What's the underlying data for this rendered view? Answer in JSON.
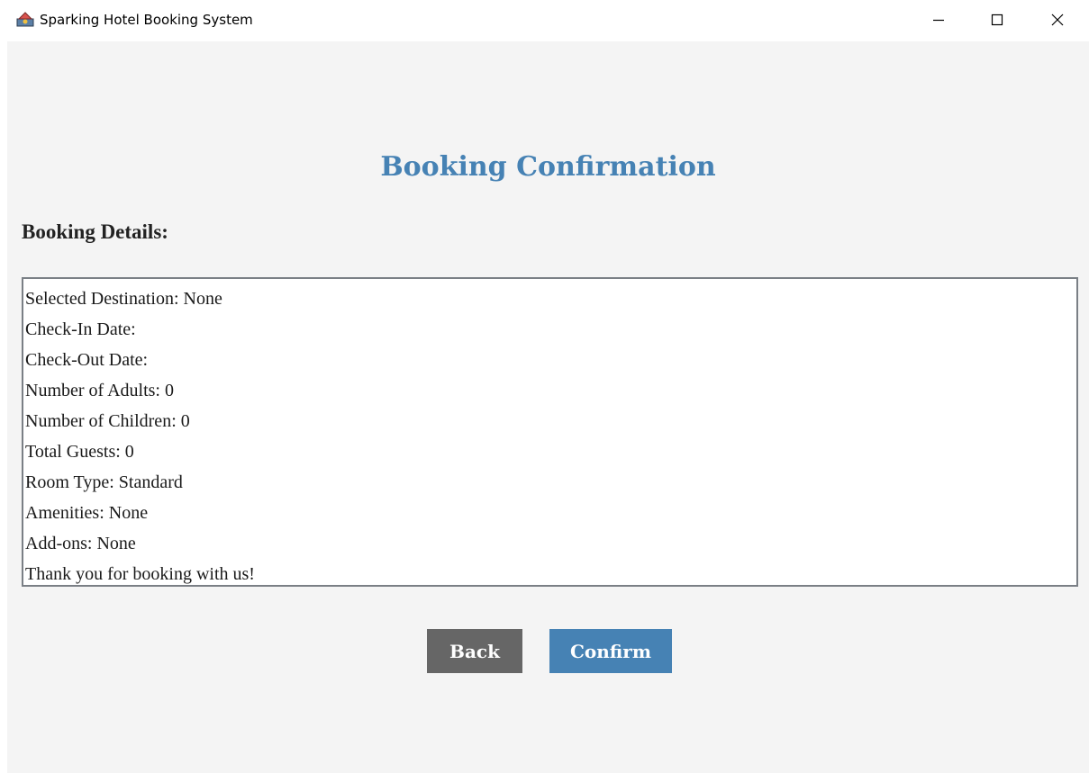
{
  "window": {
    "title": "Sparking Hotel Booking System",
    "controls": {
      "minimize": "minimize",
      "maximize": "maximize",
      "close": "close"
    }
  },
  "page": {
    "heading": "Booking Confirmation",
    "section_label": "Booking Details:",
    "details": [
      "Selected Destination: None",
      "Check-In Date: ",
      "Check-Out Date: ",
      "Number of Adults: 0",
      "Number of Children: 0",
      "Total Guests: 0",
      "Room Type: Standard",
      "Amenities: None",
      "Add-ons: None",
      "Thank you for booking with us!"
    ]
  },
  "buttons": {
    "back_label": "Back",
    "confirm_label": "Confirm"
  },
  "colors": {
    "accent": "#4682b4",
    "back_button": "#666666",
    "panel_background": "#f4f4f4"
  },
  "icons": {
    "app": "java-cup-icon",
    "minimize": "minimize-icon",
    "maximize": "maximize-icon",
    "close": "close-icon"
  }
}
